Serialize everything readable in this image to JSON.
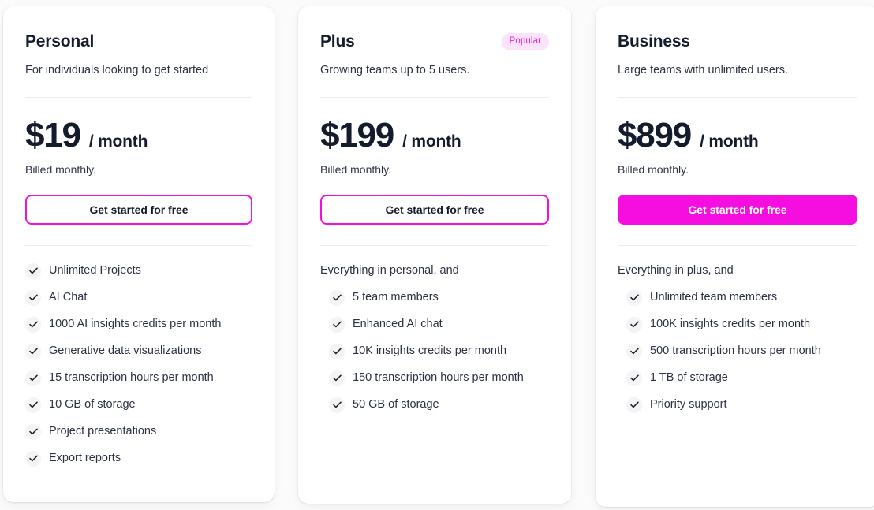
{
  "theme": {
    "accent": "#f60ee0",
    "badge_bg": "#fbe4fb",
    "badge_text": "#f31ad0",
    "text_dark": "#141b2d",
    "text_body": "#2b3242",
    "card_bg": "#ffffff",
    "page_bg": "#fbfbfb",
    "divider": "#ededf0",
    "check_bg": "#f4f4f5"
  },
  "plans": [
    {
      "name": "Personal",
      "description": "For individuals looking to get started",
      "badge": null,
      "price": "$19",
      "period": "/ month",
      "billing_note": "Billed monthly.",
      "cta_label": "Get started for free",
      "cta_style": "outline",
      "features_intro": null,
      "features": [
        "Unlimited Projects",
        "AI Chat",
        "1000 AI insights credits per month",
        "Generative data visualizations",
        "15 transcription hours per month",
        "10 GB of storage",
        "Project presentations",
        "Export reports"
      ]
    },
    {
      "name": "Plus",
      "description": "Growing teams up to 5 users.",
      "badge": "Popular",
      "price": "$199",
      "period": "/ month",
      "billing_note": "Billed monthly.",
      "cta_label": "Get started for free",
      "cta_style": "outline",
      "features_intro": "Everything in personal, and",
      "features": [
        "5 team members",
        "Enhanced AI chat",
        "10K insights credits per month",
        "150 transcription hours per month",
        "50 GB of storage"
      ]
    },
    {
      "name": "Business",
      "description": "Large teams with unlimited users.",
      "badge": null,
      "price": "$899",
      "period": "/ month",
      "billing_note": "Billed monthly.",
      "cta_label": "Get started for free",
      "cta_style": "filled",
      "features_intro": "Everything in plus, and",
      "features": [
        "Unlimited team members",
        "100K insights credits per month",
        "500 transcription hours per month",
        "1 TB of storage",
        "Priority support"
      ]
    }
  ],
  "icons": {
    "check": "check-icon"
  }
}
